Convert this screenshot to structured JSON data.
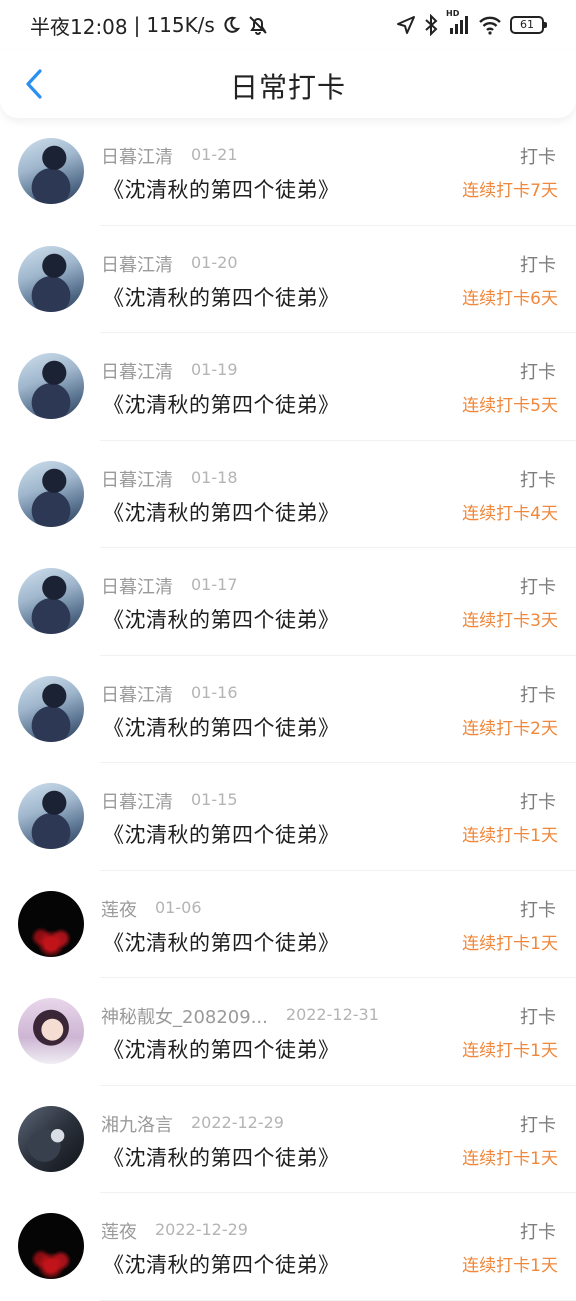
{
  "status_bar": {
    "time": "半夜12:08",
    "speed": "115K/s",
    "battery": "61",
    "network": "HD"
  },
  "header": {
    "title": "日常打卡",
    "accent_color": "#2b8ff0"
  },
  "entries": [
    {
      "user": "日暮江清",
      "date": "01-21",
      "book": "《沈清秋的第四个徒弟》",
      "action": "打卡",
      "streak": "连续打卡7天",
      "avatar": "blue"
    },
    {
      "user": "日暮江清",
      "date": "01-20",
      "book": "《沈清秋的第四个徒弟》",
      "action": "打卡",
      "streak": "连续打卡6天",
      "avatar": "blue"
    },
    {
      "user": "日暮江清",
      "date": "01-19",
      "book": "《沈清秋的第四个徒弟》",
      "action": "打卡",
      "streak": "连续打卡5天",
      "avatar": "blue"
    },
    {
      "user": "日暮江清",
      "date": "01-18",
      "book": "《沈清秋的第四个徒弟》",
      "action": "打卡",
      "streak": "连续打卡4天",
      "avatar": "blue"
    },
    {
      "user": "日暮江清",
      "date": "01-17",
      "book": "《沈清秋的第四个徒弟》",
      "action": "打卡",
      "streak": "连续打卡3天",
      "avatar": "blue"
    },
    {
      "user": "日暮江清",
      "date": "01-16",
      "book": "《沈清秋的第四个徒弟》",
      "action": "打卡",
      "streak": "连续打卡2天",
      "avatar": "blue"
    },
    {
      "user": "日暮江清",
      "date": "01-15",
      "book": "《沈清秋的第四个徒弟》",
      "action": "打卡",
      "streak": "连续打卡1天",
      "avatar": "blue"
    },
    {
      "user": "莲夜",
      "date": "01-06",
      "book": "《沈清秋的第四个徒弟》",
      "action": "打卡",
      "streak": "连续打卡1天",
      "avatar": "dark"
    },
    {
      "user": "神秘靓女_208209...",
      "date": "2022-12-31",
      "book": "《沈清秋的第四个徒弟》",
      "action": "打卡",
      "streak": "连续打卡1天",
      "avatar": "girl"
    },
    {
      "user": "湘九洛言",
      "date": "2022-12-29",
      "book": "《沈清秋的第四个徒弟》",
      "action": "打卡",
      "streak": "连续打卡1天",
      "avatar": "night"
    },
    {
      "user": "莲夜",
      "date": "2022-12-29",
      "book": "《沈清秋的第四个徒弟》",
      "action": "打卡",
      "streak": "连续打卡1天",
      "avatar": "dark"
    }
  ]
}
